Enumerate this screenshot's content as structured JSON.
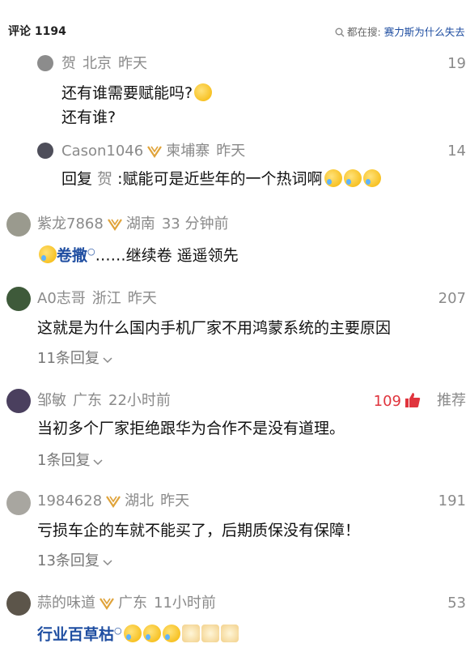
{
  "header": {
    "count_label": "评论 1194",
    "search_prefix": "都在搜:",
    "search_hot": "赛力斯为什么失去"
  },
  "comments": [
    {
      "user": "贺",
      "location": "北京",
      "time": "昨天",
      "likes": "19",
      "text_line1": "还有谁需要赋能吗?",
      "text_line2": "还有谁?"
    },
    {
      "user": "Cason1046",
      "location": "柬埔寨",
      "time": "昨天",
      "likes": "14",
      "reply_prefix": "回复 ",
      "reply_to": "贺",
      "reply_text": " :赋能可是近些年的一个热词啊"
    },
    {
      "user": "紫龙7868",
      "location": "湖南",
      "time": "33 分钟前",
      "topic": "卷撒",
      "text": "……继续卷  遥遥领先"
    },
    {
      "user": "A0志哥",
      "location": "浙江",
      "time": "昨天",
      "likes": "207",
      "text": "这就是为什么国内手机厂家不用鸿蒙系统的主要原因",
      "replies": "11条回复"
    },
    {
      "user": "邹敏",
      "location": "广东",
      "time": "22小时前",
      "likes": "109",
      "recommend": "推荐",
      "text": "当初多个厂家拒绝跟华为合作不是没有道理。",
      "replies": "1条回复"
    },
    {
      "user": "1984628",
      "location": "湖北",
      "time": "昨天",
      "likes": "191",
      "text": "亏损车企的车就不能买了，后期质保没有保障！",
      "replies": "13条回复"
    },
    {
      "user": "蒜的味道",
      "location": "广东",
      "time": "11小时前",
      "likes": "53",
      "topic": "行业百草枯"
    }
  ],
  "colors": {
    "meta_gray": "#8a8a8a",
    "hot_red": "#e0343d",
    "link_blue": "#1f4ea1",
    "vip_gold": "#e0a33a"
  },
  "icons": [
    "search-icon",
    "vip-badge-icon",
    "chevron-down-icon",
    "thumb-up-icon",
    "search-superscript-icon",
    "cry-laugh-emoji",
    "cat-emoji"
  ]
}
